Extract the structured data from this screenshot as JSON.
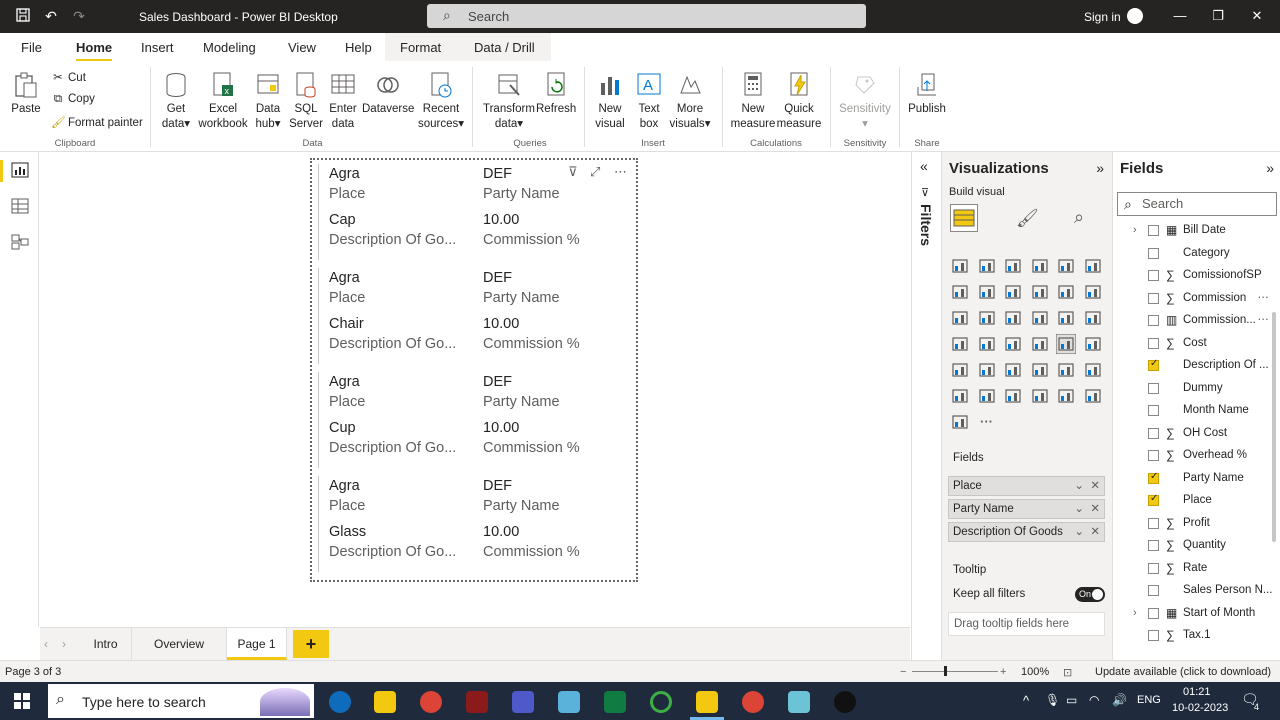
{
  "window": {
    "title": "Sales Dashboard - Power BI Desktop",
    "search_placeholder": "Search",
    "signin": "Sign in"
  },
  "tabs": [
    "File",
    "Home",
    "Insert",
    "Modeling",
    "View",
    "Help",
    "Format",
    "Data / Drill"
  ],
  "ribbon": {
    "clipboard": {
      "paste": "Paste",
      "cut": "Cut",
      "copy": "Copy",
      "format_painter": "Format painter",
      "group": "Clipboard"
    },
    "data": {
      "get_data": [
        "Get",
        "data"
      ],
      "excel": [
        "Excel",
        "workbook"
      ],
      "data_hub": [
        "Data",
        "hub"
      ],
      "sql": [
        "SQL",
        "Server"
      ],
      "enter": [
        "Enter",
        "data"
      ],
      "dataverse": "Dataverse",
      "recent": [
        "Recent",
        "sources"
      ],
      "group": "Data"
    },
    "queries": {
      "transform": [
        "Transform",
        "data"
      ],
      "refresh": "Refresh",
      "group": "Queries"
    },
    "insert": {
      "new_visual": [
        "New",
        "visual"
      ],
      "text_box": [
        "Text",
        "box"
      ],
      "more_visuals": [
        "More",
        "visuals"
      ],
      "group": "Insert"
    },
    "calculations": {
      "new_measure": [
        "New",
        "measure"
      ],
      "quick_measure": [
        "Quick",
        "measure"
      ],
      "group": "Calculations"
    },
    "sensitivity": {
      "label": "Sensitivity",
      "group": "Sensitivity"
    },
    "share": {
      "publish": "Publish",
      "group": "Share"
    }
  },
  "cards": [
    {
      "place": "Agra",
      "place_label": "Place",
      "party": "DEF",
      "party_label": "Party Name",
      "goods": "Cap",
      "goods_label": "Description Of Go...",
      "commission": "10.00",
      "commission_label": "Commission %"
    },
    {
      "place": "Agra",
      "place_label": "Place",
      "party": "DEF",
      "party_label": "Party Name",
      "goods": "Chair",
      "goods_label": "Description Of Go...",
      "commission": "10.00",
      "commission_label": "Commission %"
    },
    {
      "place": "Agra",
      "place_label": "Place",
      "party": "DEF",
      "party_label": "Party Name",
      "goods": "Cup",
      "goods_label": "Description Of Go...",
      "commission": "10.00",
      "commission_label": "Commission %"
    },
    {
      "place": "Agra",
      "place_label": "Place",
      "party": "DEF",
      "party_label": "Party Name",
      "goods": "Glass",
      "goods_label": "Description Of Go...",
      "commission": "10.00",
      "commission_label": "Commission %"
    }
  ],
  "pages": [
    "Intro",
    "Overview",
    "Page 1"
  ],
  "active_page": "Page 1",
  "filters_label": "Filters",
  "visualizations": {
    "title": "Visualizations",
    "build_visual": "Build visual",
    "fields_title": "Fields",
    "wells": [
      "Place",
      "Party Name",
      "Description Of Goods"
    ],
    "tooltip_title": "Tooltip",
    "keep_filters": "Keep all filters",
    "toggle": "On",
    "drag_tooltip": "Drag tooltip fields here",
    "more_glyph": "···"
  },
  "fields": {
    "title": "Fields",
    "search_placeholder": "Search",
    "items": [
      {
        "name": "Bill Date",
        "type": "table",
        "checked": false,
        "expand": true
      },
      {
        "name": "Category",
        "type": "text",
        "checked": false
      },
      {
        "name": "ComissionofSP",
        "type": "sum",
        "checked": false
      },
      {
        "name": "Commission",
        "type": "sum",
        "checked": false,
        "more": true
      },
      {
        "name": "Commission...",
        "type": "calc",
        "checked": false,
        "more": true
      },
      {
        "name": "Cost",
        "type": "sum",
        "checked": false
      },
      {
        "name": "Description Of ...",
        "type": "text",
        "checked": true
      },
      {
        "name": "Dummy",
        "type": "text",
        "checked": false
      },
      {
        "name": "Month Name",
        "type": "text",
        "checked": false
      },
      {
        "name": "OH Cost",
        "type": "sum",
        "checked": false
      },
      {
        "name": "Overhead %",
        "type": "sum",
        "checked": false
      },
      {
        "name": "Party Name",
        "type": "text",
        "checked": true
      },
      {
        "name": "Place",
        "type": "text",
        "checked": true
      },
      {
        "name": "Profit",
        "type": "sum",
        "checked": false
      },
      {
        "name": "Quantity",
        "type": "sum",
        "checked": false
      },
      {
        "name": "Rate",
        "type": "sum",
        "checked": false
      },
      {
        "name": "Sales Person N...",
        "type": "text",
        "checked": false
      },
      {
        "name": "Start of Month",
        "type": "table",
        "checked": false,
        "expand": true
      },
      {
        "name": "Tax.1",
        "type": "sum",
        "checked": false
      }
    ]
  },
  "status": {
    "page": "Page 3 of 3",
    "zoom": "100%",
    "update": "Update available (click to download)"
  },
  "taskbar": {
    "search_placeholder": "Type here to search",
    "lang": "ENG",
    "time": "01:21",
    "date": "10-02-2023",
    "notifications": "4"
  },
  "colors": {
    "accent": "#F2C811",
    "titlebar": "#252423",
    "pane": "#f3f2f1"
  }
}
